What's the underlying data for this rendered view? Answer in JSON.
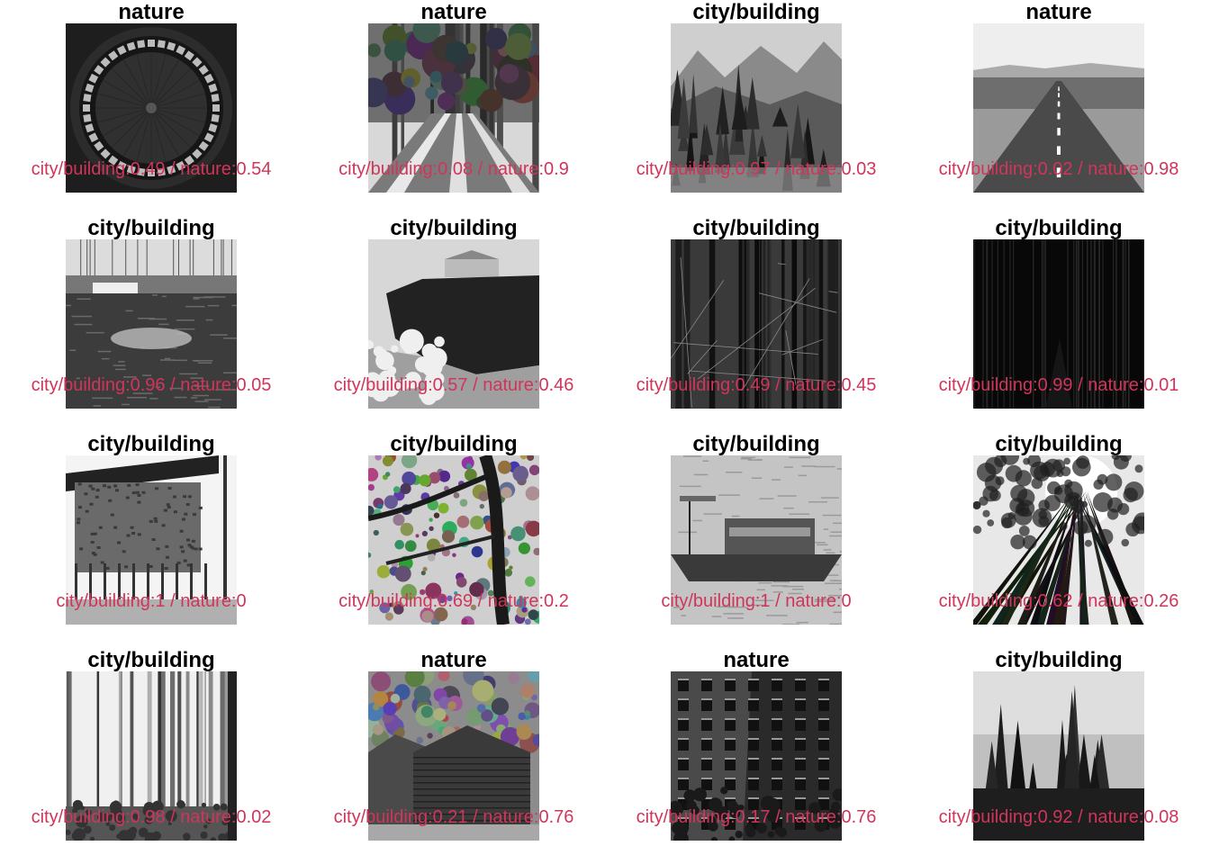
{
  "figure": {
    "caption_color": "#d0355a",
    "title_color": "#000000",
    "panels": [
      {
        "title": "nature",
        "caption": "city/building:0.49 / nature:0.54",
        "scene": "dome-ceiling"
      },
      {
        "title": "nature",
        "caption": "city/building:0.08 / nature:0.9",
        "scene": "tree-lined-street"
      },
      {
        "title": "city/building",
        "caption": "city/building:0.97 / nature:0.03",
        "scene": "mountain-valley"
      },
      {
        "title": "nature",
        "caption": "city/building:0.02 / nature:0.98",
        "scene": "straight-road"
      },
      {
        "title": "city/building",
        "caption": "city/building:0.96 / nature:0.05",
        "scene": "harbor-boats"
      },
      {
        "title": "city/building",
        "caption": "city/building:0.57 / nature:0.46",
        "scene": "cliff-house-waves"
      },
      {
        "title": "city/building",
        "caption": "city/building:0.49 / nature:0.45",
        "scene": "dark-forest"
      },
      {
        "title": "city/building",
        "caption": "city/building:0.99 / nature:0.01",
        "scene": "very-dark-forest"
      },
      {
        "title": "city/building",
        "caption": "city/building:1 / nature:0",
        "scene": "stilt-hut"
      },
      {
        "title": "city/building",
        "caption": "city/building:0.69 / nature:0.2",
        "scene": "tree-branches"
      },
      {
        "title": "city/building",
        "caption": "city/building:1 / nature:0",
        "scene": "fishing-boat"
      },
      {
        "title": "city/building",
        "caption": "city/building:0.62 / nature:0.26",
        "scene": "forest-canopy"
      },
      {
        "title": "city/building",
        "caption": "city/building:0.98 / nature:0.02",
        "scene": "misty-forest"
      },
      {
        "title": "nature",
        "caption": "city/building:0.21 / nature:0.76",
        "scene": "wooden-cabin"
      },
      {
        "title": "nature",
        "caption": "city/building:0.17 / nature:0.76",
        "scene": "building-facade"
      },
      {
        "title": "city/building",
        "caption": "city/building:0.92 / nature:0.08",
        "scene": "pine-trees"
      }
    ]
  }
}
